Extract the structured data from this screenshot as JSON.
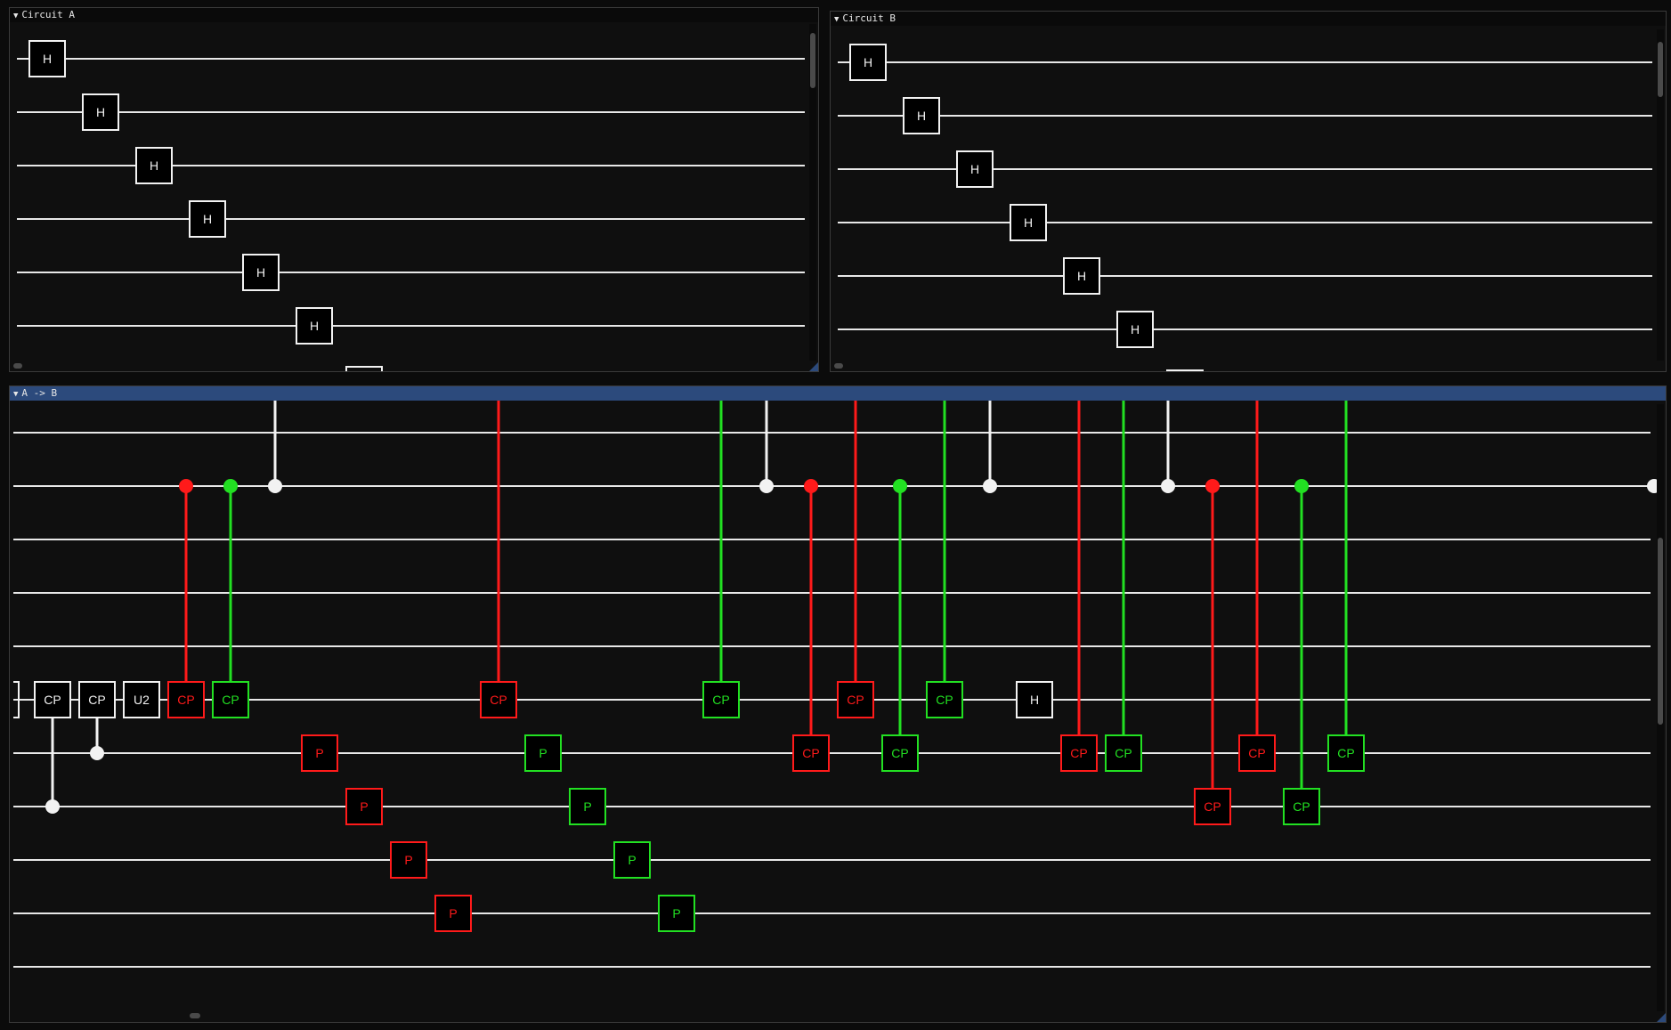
{
  "colors": {
    "wire": "#e8e8e8",
    "red": "#ff1a1a",
    "green": "#22e022",
    "white": "#f2f2f2"
  },
  "windows": {
    "circuit_a": {
      "title": "Circuit A",
      "gate_label": "H"
    },
    "circuit_b": {
      "title": "Circuit B",
      "gate_label": "H"
    },
    "a_to_b": {
      "title": "A -> B",
      "labels": {
        "cp": "CP",
        "u2": "U2",
        "p": "P",
        "h": "H"
      }
    }
  }
}
